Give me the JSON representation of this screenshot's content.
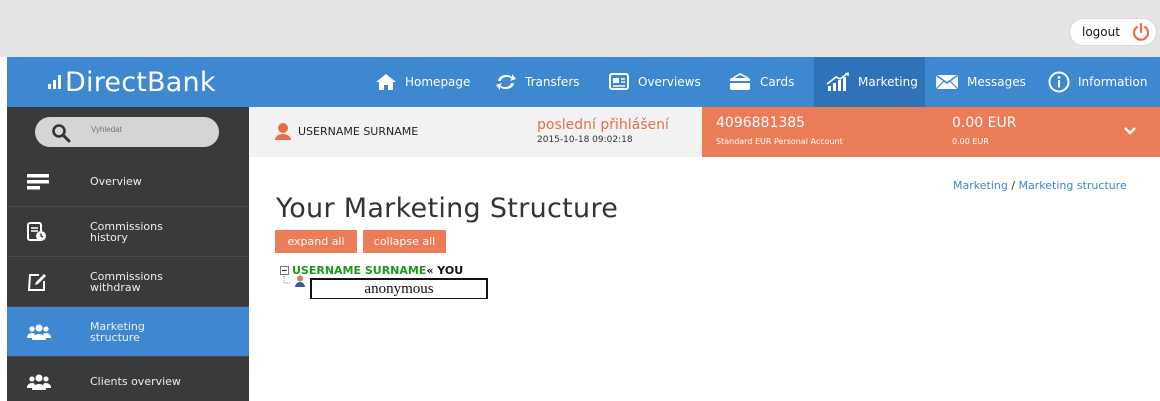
{
  "header": {
    "logout_label": "logout"
  },
  "brand": {
    "logo_text": "DirectBank"
  },
  "nav": {
    "items": [
      {
        "label": "Homepage",
        "icon": "home-icon"
      },
      {
        "label": "Transfers",
        "icon": "transfers-icon"
      },
      {
        "label": "Overviews",
        "icon": "overviews-icon"
      },
      {
        "label": "Cards",
        "icon": "cards-icon"
      },
      {
        "label": "Marketing",
        "icon": "marketing-chart-icon",
        "active": true
      },
      {
        "label": "Messages",
        "icon": "envelope-icon"
      },
      {
        "label": "Information",
        "icon": "info-icon"
      }
    ]
  },
  "search": {
    "placeholder": "Vyhledat"
  },
  "user": {
    "name": "USERNAME SURNAME"
  },
  "last_login": {
    "label": "poslední přihlášení",
    "datetime": "2015-10-18 09:02:18"
  },
  "account": {
    "number": "4096881385",
    "type": "Standard EUR Personal Account",
    "balance": "0.00 EUR",
    "balance_sub": "0.00 EUR"
  },
  "sidebar": {
    "items": [
      {
        "label": "Overview",
        "icon": "list-icon"
      },
      {
        "label": "Commissions\nhistory",
        "icon": "history-icon"
      },
      {
        "label": "Commissions\nwithdraw",
        "icon": "edit-icon"
      },
      {
        "label": "Marketing\nstructure",
        "icon": "users-icon",
        "active": true
      },
      {
        "label": "Clients overview",
        "icon": "users-icon"
      }
    ]
  },
  "breadcrumb": {
    "parent": "Marketing",
    "separator": "/",
    "current": "Marketing structure"
  },
  "page": {
    "title": "Your Marketing Structure"
  },
  "buttons": {
    "expand_all": "expand all",
    "collapse_all": "collapse all"
  },
  "tree": {
    "root_name": "USERNAME SURNAME",
    "root_suffix": "« YOU",
    "child_label": "anonymous"
  },
  "colors": {
    "nav_blue": "#3e87d1",
    "accent_orange": "#ea7c58",
    "sidebar_dark": "#3a3a3a",
    "tree_green": "#1a9a1a"
  }
}
